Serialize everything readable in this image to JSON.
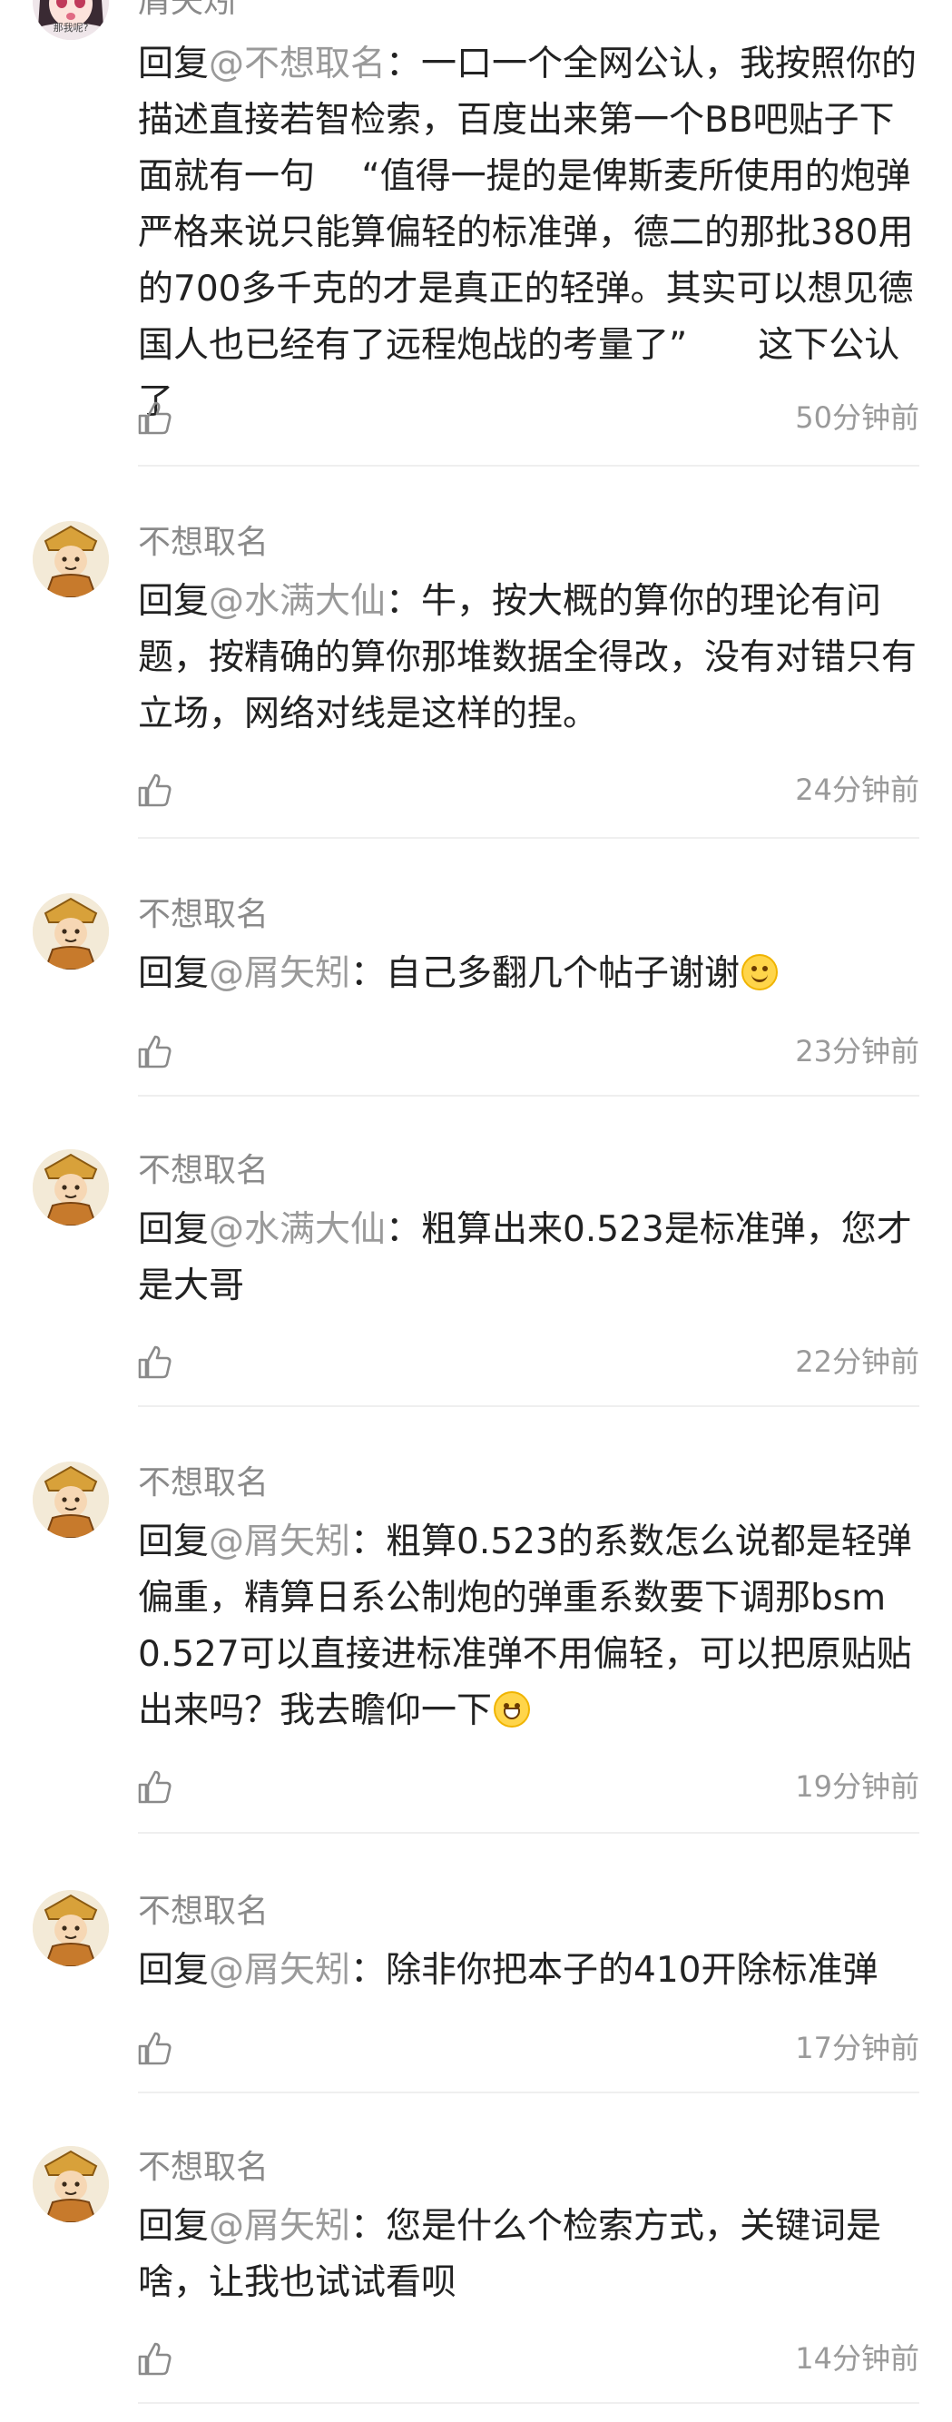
{
  "comments": [
    {
      "username": "屑矢矧",
      "reply_prefix": "回复",
      "mention": "@不想取名",
      "colon": "：",
      "text": "一口一个全网公认，我按照你的描述直接若智检索，百度出来第一个BB吧贴子下面就有一句　 “值得一提的是俾斯麦所使用的炮弹严格来说只能算偏轻的标准弹，德二的那批380用的700多千克的才是真正的轻弹。其实可以想见德国人也已经有了远程炮战的考量了”　　这下公认了",
      "time": "50分钟前",
      "avatar_caption": "那我呢?"
    },
    {
      "username": "不想取名",
      "reply_prefix": "回复",
      "mention": "@水满大仙",
      "colon": "：",
      "text": "牛，按大概的算你的理论有问题，按精确的算你那堆数据全得改，没有对错只有立场，网络对线是这样的捏。",
      "time": "24分钟前"
    },
    {
      "username": "不想取名",
      "reply_prefix": "回复",
      "mention": "@屑矢矧",
      "colon": "：",
      "text": "自己多翻几个帖子谢谢",
      "emoji": "smile-emoji",
      "time": "23分钟前"
    },
    {
      "username": "不想取名",
      "reply_prefix": "回复",
      "mention": "@水满大仙",
      "colon": "：",
      "text": "粗算出来0.523是标准弹，您才是大哥",
      "time": "22分钟前"
    },
    {
      "username": "不想取名",
      "reply_prefix": "回复",
      "mention": "@屑矢矧",
      "colon": "：",
      "text": "粗算0.523的系数怎么说都是轻弹偏重，精算日系公制炮的弹重系数要下调那bsm0.527可以直接进标准弹不用偏轻，可以把原贴贴出来吗？我去瞻仰一下",
      "emoji": "grin-emoji",
      "time": "19分钟前"
    },
    {
      "username": "不想取名",
      "reply_prefix": "回复",
      "mention": "@屑矢矧",
      "colon": "：",
      "text": "除非你把本子的410开除标准弹",
      "time": "17分钟前"
    },
    {
      "username": "不想取名",
      "reply_prefix": "回复",
      "mention": "@屑矢矧",
      "colon": "：",
      "text": "您是什么个检索方式，关键词是啥，让我也试试看呗",
      "time": "14分钟前"
    }
  ]
}
